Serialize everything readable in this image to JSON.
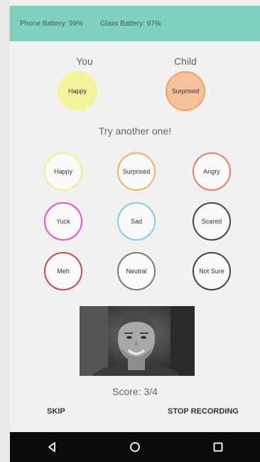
{
  "status": {
    "phone_battery": "Phone Battery: 99%",
    "glass_battery": "Glass Battery: 97%"
  },
  "header": {
    "you_label": "You",
    "child_label": "Child",
    "you_emotion": "Happy",
    "child_emotion": "Surprised"
  },
  "prompt": "Try another one!",
  "emotions": [
    {
      "label": "Happy",
      "color": "#f2f08a"
    },
    {
      "label": "Surprised",
      "color": "#f5b062"
    },
    {
      "label": "Angry",
      "color": "#ef7b66"
    },
    {
      "label": "Yuck",
      "color": "#ea4fd9"
    },
    {
      "label": "Sad",
      "color": "#86c9ee"
    },
    {
      "label": "Scared",
      "color": "#444444"
    },
    {
      "label": "Meh",
      "color": "#c94b4b"
    },
    {
      "label": "Neutral",
      "color": "#7a7a7a"
    },
    {
      "label": "Not Sure",
      "color": "#444444"
    }
  ],
  "score": "Score: 3/4",
  "actions": {
    "skip": "SKIP",
    "stop": "STOP RECORDING"
  },
  "colors": {
    "status_bar": "#7fd1c0",
    "you_fill": "#f5f39b",
    "child_fill": "#f4c19a"
  },
  "icons": {
    "back": "back-triangle-icon",
    "home": "home-circle-icon",
    "recents": "recents-square-icon"
  }
}
